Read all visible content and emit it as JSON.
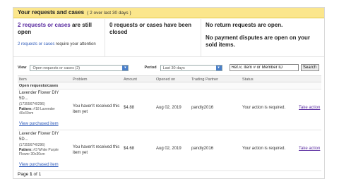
{
  "header": {
    "title": "Your requests and cases",
    "subtitle": "( 2 over last 30 days )"
  },
  "summary": {
    "col1": {
      "count": "2",
      "text_highlight": "requests or cases",
      "text_rest": " are still open",
      "link": "2 requests or cases",
      "link_rest": " require your attention"
    },
    "col2": {
      "text": "0 requests or cases have been closed"
    },
    "col3": {
      "line1": "No return requests are open.",
      "line2": "No payment disputes are open on your sold items."
    }
  },
  "filters": {
    "view_label": "View",
    "view_value": "Open requests or cases (2)",
    "period_label": "Period",
    "period_value": "Last 30 days",
    "search_value": "Ref.#, Item # or Member ID",
    "search_button": "Search"
  },
  "table": {
    "columns": [
      "Item",
      "Problem",
      "Amount",
      "Opened on",
      "Trading Partner",
      "Status"
    ],
    "group_label": "Open requests/cases",
    "rows": [
      {
        "title": "Lavender Flower DIY 5D...",
        "item_id": "(173556740296)",
        "pattern_label": "Pattern:",
        "pattern_value": "#18 Lavender 40x30cm",
        "view_link": "View purchased item",
        "problem": "You haven't received this item yet",
        "amount": "$4.88",
        "opened": "Aug 02, 2019",
        "partner": "pandiy2016",
        "status": "Your action is required.",
        "action": "Take action"
      },
      {
        "title": "Lavender Flower DIY 5D...",
        "item_id": "(173556740296)",
        "pattern_label": "Pattern:",
        "pattern_value": "#3 White Purple Flower 30x30cm",
        "view_link": "View purchased item",
        "problem": "You haven't received this item yet",
        "amount": "$4.68",
        "opened": "Aug 02, 2019",
        "partner": "pandiy2016",
        "status": "Your action is required.",
        "action": "Take action"
      }
    ]
  },
  "pager": {
    "page_label": "Page",
    "current": "1",
    "of_label": "of",
    "total": "1"
  },
  "colors": {
    "header_bg": "#fbe68c",
    "accent_purple": "#5a2ca0",
    "link_blue": "#2a57b8"
  }
}
